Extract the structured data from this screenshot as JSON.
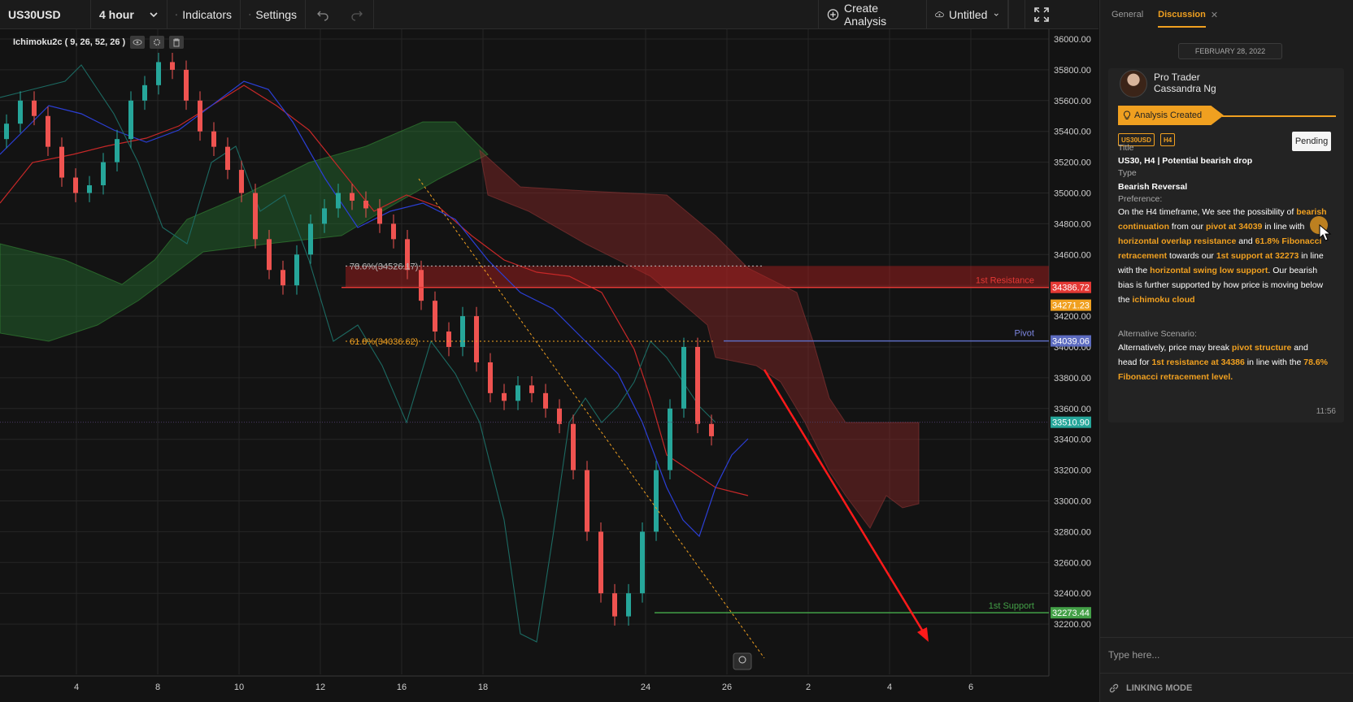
{
  "toolbar": {
    "symbol": "US30USD",
    "interval": "4 hour",
    "indicators": "Indicators",
    "settings": "Settings",
    "create_analysis": "Create Analysis",
    "layout_name": "Untitled"
  },
  "chart": {
    "indicator_label": "Ichimoku2c ( 9, 26, 52, 26 )",
    "price_ticks": [
      "36000.00",
      "35800.00",
      "35600.00",
      "35400.00",
      "35200.00",
      "35000.00",
      "34800.00",
      "34600.00",
      "34400.00",
      "34200.00",
      "34000.00",
      "33800.00",
      "33600.00",
      "33400.00",
      "33200.00",
      "33000.00",
      "32800.00",
      "32600.00",
      "32400.00",
      "32200.00"
    ],
    "date_ticks": [
      "4",
      "8",
      "10",
      "12",
      "16",
      "18",
      "24",
      "26",
      "2",
      "4",
      "6"
    ],
    "levels": {
      "resistance_label": "1st Resistance",
      "resistance_price": "34386.72",
      "orange_price": "34271.23",
      "pivot_label": "Pivot",
      "pivot_price": "34039.06",
      "current_price": "33510.90",
      "support_label": "1st Support",
      "support_price": "32273.44",
      "fib_786": "78.6%(34526.17)",
      "fib_618": "61.8%(34036.62)"
    },
    "colors": {
      "bull": "#26a69a",
      "bear": "#ef5350",
      "resistance": "#e53935",
      "pivot": "#5c6bc0",
      "support": "#43a047",
      "orange": "#f0a020",
      "arrow": "#ff1a1a"
    }
  },
  "panel": {
    "tabs": [
      "General",
      "Discussion"
    ],
    "date": "FEBRUARY 28, 2022",
    "author_role": "Pro Trader",
    "author_name": "Cassandra Ng",
    "status": "Analysis Created",
    "tags": [
      "US30USD",
      "H4"
    ],
    "pending": "Pending",
    "title_label": "Title",
    "title_value": "US30, H4 | Potential bearish drop",
    "type_label": "Type",
    "type_value": "Bearish Reversal",
    "preference_label": "Preference:",
    "preference": {
      "t1": "On the H4 timeframe, We see the possibility of ",
      "h1": "bearish continuation",
      "t2": " from our ",
      "h2": "pivot at 34039",
      "t3": " in line with ",
      "h3": "horizontal overlap resistance",
      "t4": " and ",
      "h4": "61.8% Fibonacci retracement",
      "t5": " towards our ",
      "h5": "1st support at 32273",
      "t6": " in line with the ",
      "h6": "horizontal swing low support",
      "t7": ". Our bearish bias is further supported by how price is moving below the ",
      "h7": "ichimoku cloud"
    },
    "alt_label": "Alternative Scenario:",
    "alternative": {
      "t1": "Alternatively, price may break ",
      "h1": "pivot structure",
      "t2": " and head for ",
      "h2": "1st resistance at 34386",
      "t3": " in line with the ",
      "h3": "78.6% Fibonacci retracement level."
    },
    "time": "11:56",
    "input_placeholder": "Type here...",
    "linking_mode": "LINKING MODE"
  }
}
